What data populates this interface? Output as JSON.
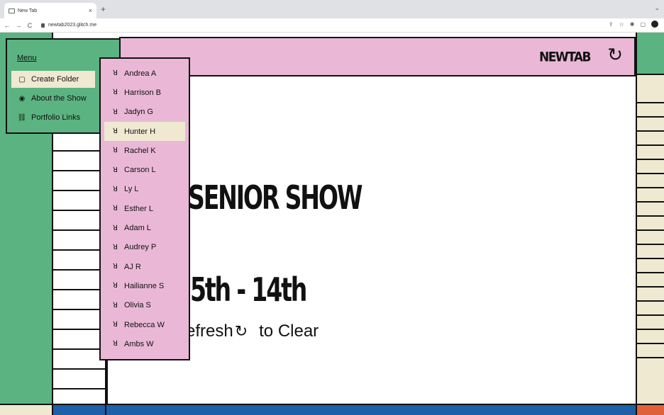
{
  "browser": {
    "tab_title": "New Tab",
    "tab_close": "×",
    "new_tab": "+",
    "url": "newtab2023.glitch.me",
    "nav": {
      "back": "←",
      "forward": "→",
      "reload": "C"
    }
  },
  "header": {
    "logo": "NEWTAB",
    "refresh_icon": "↻"
  },
  "menu": {
    "title": "Menu",
    "items": [
      {
        "label": "Create Folder",
        "icon": "folder-icon",
        "glyph": "▢"
      },
      {
        "label": "About the Show",
        "icon": "eye-icon",
        "glyph": "◉"
      },
      {
        "label": "Portfolio Links",
        "icon": "link-icon",
        "glyph": "⛓"
      }
    ]
  },
  "dropdown": {
    "items": [
      "Andrea A",
      "Harrison B",
      "Jadyn G",
      "Hunter H",
      "Rachel K",
      "Carson L",
      "Ly L",
      "Esther L",
      "Adam L",
      "Audrey P",
      "AJ R",
      "Hailianne S",
      "Olivia S",
      "Rebecca W",
      "Ambs W"
    ],
    "hovered_index": 3,
    "item_icon": "person-icon"
  },
  "main": {
    "title": "SENIOR SHOW",
    "date": "5th - 14th",
    "refresh_prefix": "efresh",
    "refresh_suffix": "to Clear"
  },
  "colors": {
    "green": "#5bb381",
    "pink": "#eab8d6",
    "beige": "#efe9d2",
    "blue": "#1d5fa8",
    "orange": "#e0603a"
  }
}
